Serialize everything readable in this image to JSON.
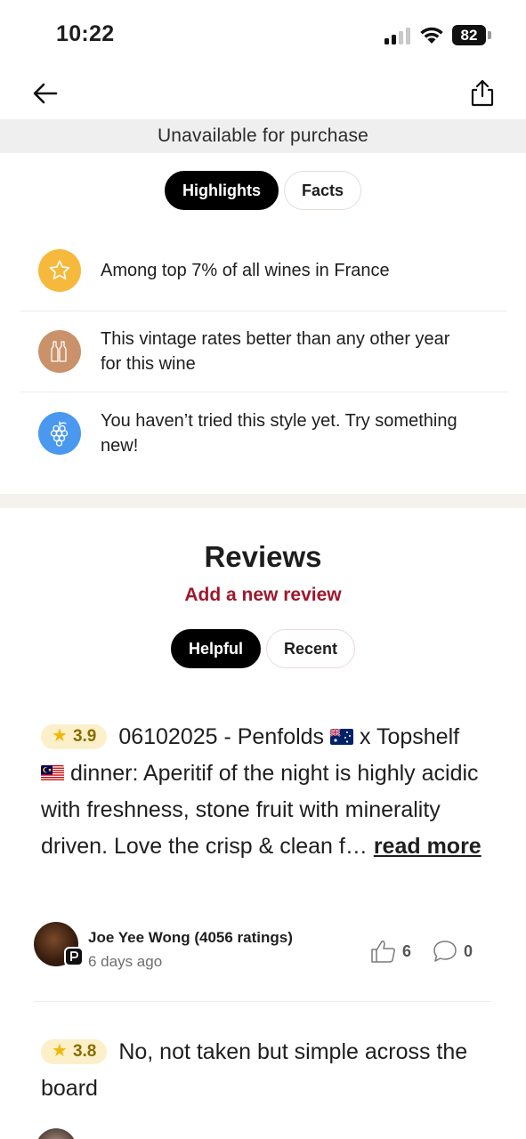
{
  "status_bar": {
    "time": "10:22",
    "battery": "82"
  },
  "nav": {
    "back_icon": "arrow-left-icon",
    "share_icon": "share-icon"
  },
  "availability_banner": "Unavailable for purchase",
  "top_tabs": [
    {
      "label": "Highlights",
      "active": true
    },
    {
      "label": "Facts",
      "active": false
    }
  ],
  "highlights": [
    {
      "icon": "star-icon",
      "color": "#F6B93B",
      "text": "Among top 7% of all wines in France"
    },
    {
      "icon": "bottles-icon",
      "color": "#C9926A",
      "text": "This vintage rates better than any other year for this wine"
    },
    {
      "icon": "grapes-icon",
      "color": "#4A98F0",
      "text": "You haven’t tried this style yet. Try something new!"
    }
  ],
  "reviews": {
    "title": "Reviews",
    "add_review": "Add a new review",
    "tabs": [
      {
        "label": "Helpful",
        "active": true
      },
      {
        "label": "Recent",
        "active": false
      }
    ],
    "items": [
      {
        "rating": "3.9",
        "text_part1": "06102025 - Penfolds",
        "text_part2": "x Topshelf",
        "text_part3": "dinner: Aperitif of the night is highly acidic with freshness, stone fruit with minerality driven. Love the crisp & clean f…",
        "read_more": "read more",
        "reviewer_name": "Joe Yee Wong (4056 ratings)",
        "date": "6 days ago",
        "likes": "6",
        "comments": "0"
      },
      {
        "rating": "3.8",
        "text": "No, not taken but simple across the board"
      }
    ]
  },
  "colors": {
    "accent": "#A0172B",
    "rating_bg": "#FBF0C9",
    "rating_star": "#F2B705"
  }
}
